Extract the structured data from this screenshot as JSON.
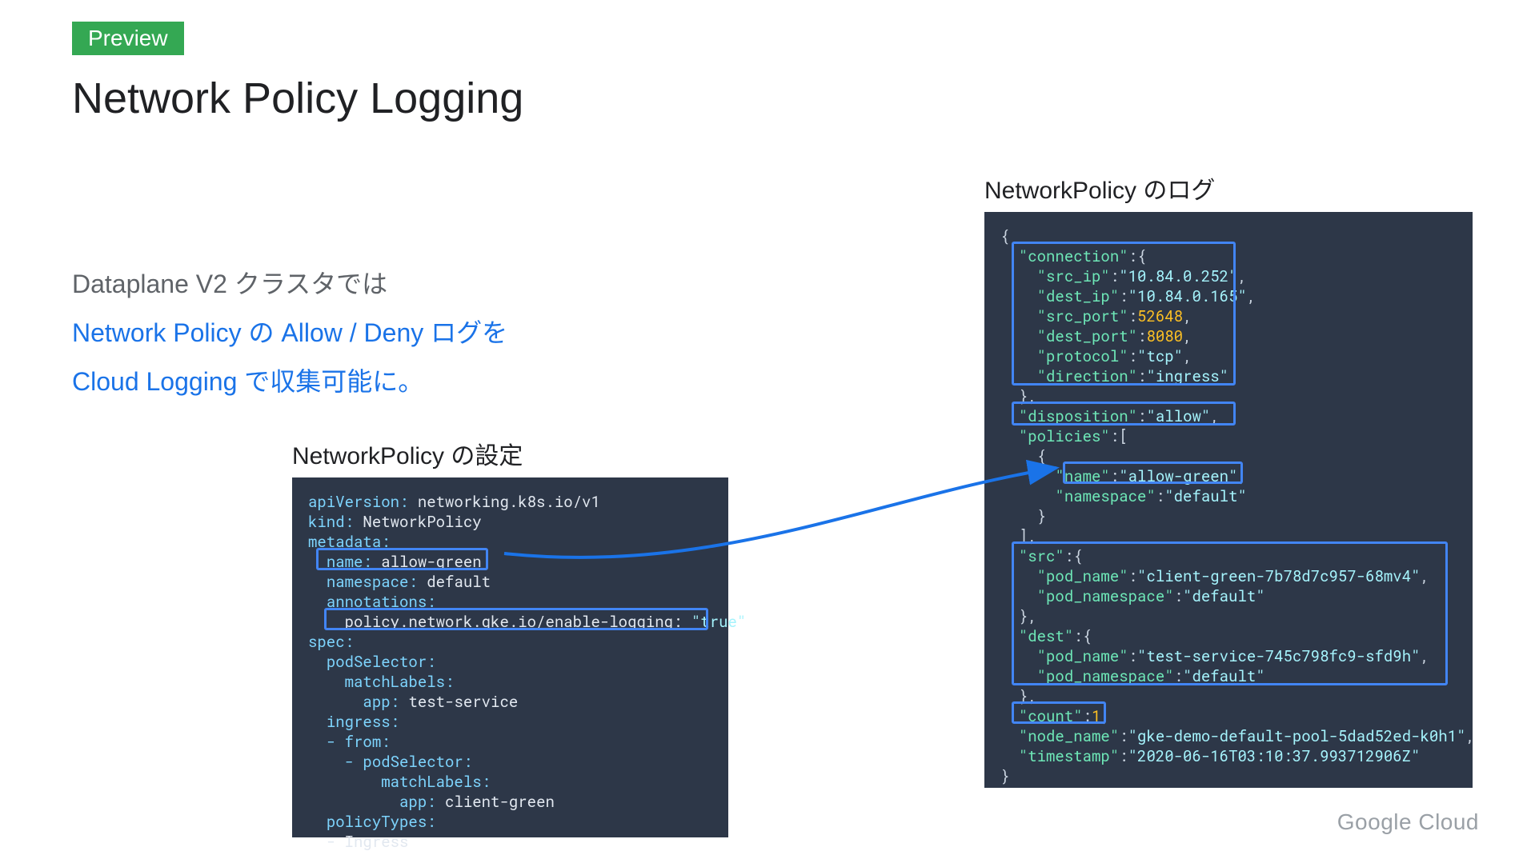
{
  "badge": "Preview",
  "title": "Network Policy Logging",
  "description": {
    "line1": "Dataplane V2 クラスタでは",
    "line2": "Network Policy の Allow / Deny ログを",
    "line3": "Cloud Logging で収集可能に。"
  },
  "leftHeading": "NetworkPolicy の設定",
  "rightHeading": "NetworkPolicy のログ",
  "yaml": {
    "apiVersion": "networking.k8s.io/v1",
    "kind": "NetworkPolicy",
    "metadataLabel": "metadata:",
    "name": "allow-green",
    "namespace": "default",
    "annotationsLabel": "annotations:",
    "loggingKey": "policy.network.gke.io/enable-logging:",
    "loggingVal": "\"true\"",
    "specLabel": "spec:",
    "podSelectorLabel": "podSelector:",
    "matchLabelsLabel": "matchLabels:",
    "appKey": "app:",
    "appVal1": "test-service",
    "ingressLabel": "ingress:",
    "fromLabel": "- from:",
    "podSelector2": "- podSelector:",
    "appVal2": "client-green",
    "policyTypesLabel": "policyTypes:",
    "policyTypesVal": "- Ingress"
  },
  "log": {
    "connection": {
      "src_ip": "10.84.0.252",
      "dest_ip": "10.84.0.165",
      "src_port": 52648,
      "dest_port": 8080,
      "protocol": "tcp",
      "direction": "ingress"
    },
    "disposition": "allow",
    "policy_name": "allow-green",
    "policy_namespace": "default",
    "src_pod_name": "client-green-7b78d7c957-68mv4",
    "src_pod_namespace": "default",
    "dest_pod_name": "test-service-745c798fc9-sfd9h",
    "dest_pod_namespace": "default",
    "count": 1,
    "node_name": "gke-demo-default-pool-5dad52ed-k0h1",
    "timestamp": "2020-06-16T03:10:37.993712906Z"
  },
  "footer": {
    "brand1": "Google",
    "brand2": " Cloud"
  }
}
